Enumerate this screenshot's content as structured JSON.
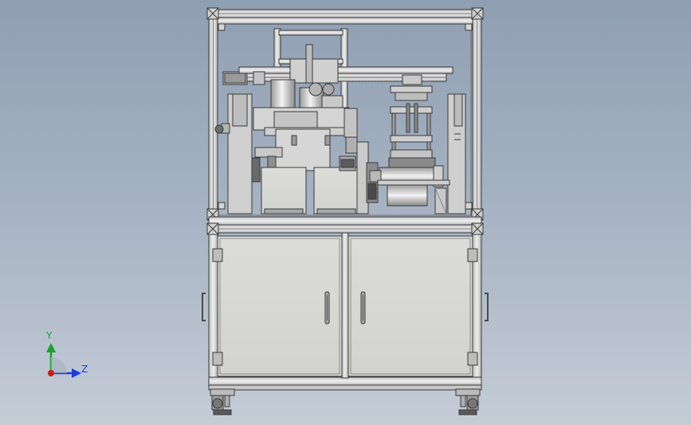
{
  "viewport": {
    "background_top": "#8f9fb2",
    "background_bottom": "#c4ccd6",
    "model_name": "",
    "model_fill": "#d9d9d9",
    "model_stroke": "#3a3a3a"
  },
  "triad": {
    "y_label": "Y",
    "z_label": "Z",
    "y_color": "#19a32a",
    "z_color": "#1a3fd6",
    "x_color": "#d11a1a",
    "icon": "coordinate-triad-icon"
  }
}
